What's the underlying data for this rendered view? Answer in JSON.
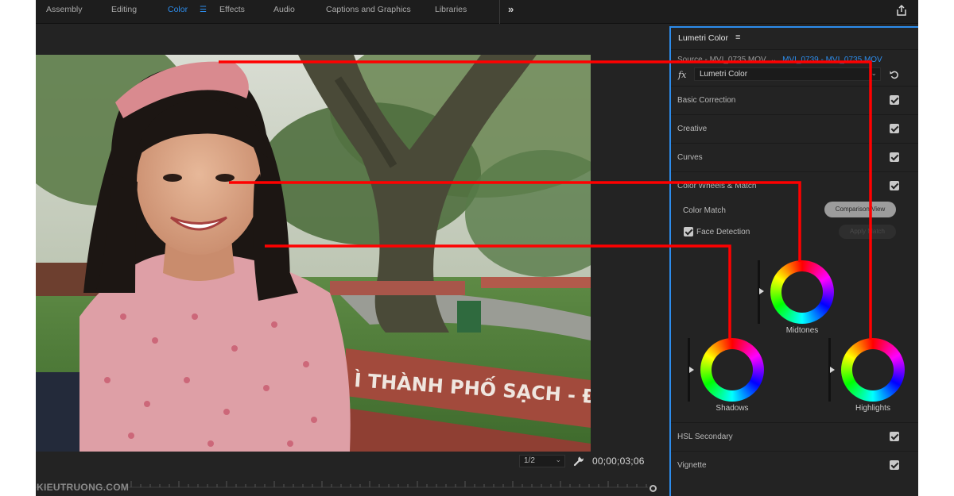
{
  "workspaces": {
    "tabs": [
      {
        "label": "Assembly"
      },
      {
        "label": "Editing"
      },
      {
        "label": "Color"
      },
      {
        "label": "Effects"
      },
      {
        "label": "Audio"
      },
      {
        "label": "Captions and Graphics"
      },
      {
        "label": "Libraries"
      }
    ],
    "active": "Color",
    "more_icon": "double-chevron-right-icon",
    "share_icon": "export-share-icon"
  },
  "monitor": {
    "bench_sign_text": "Ì THÀNH PHỐ SẠCH - ĐẸ",
    "resolution": "1/2",
    "timecode": "00;00;03;06",
    "watermark": "KIEUTRUONG.COM"
  },
  "lumetri": {
    "title": "Lumetri Color",
    "source_label": "Source - MVI_0735.MOV",
    "sequence_label": "MVI_0739 - MVI_0735.MOV",
    "fx_label": "fx",
    "effect_name": "Lumetri Color",
    "sections": [
      {
        "label": "Basic Correction",
        "checked": true
      },
      {
        "label": "Creative",
        "checked": true
      },
      {
        "label": "Curves",
        "checked": true
      },
      {
        "label": "Color Wheels & Match",
        "checked": true
      }
    ],
    "color_match": {
      "label": "Color Match",
      "comparison_button": "Comparison View",
      "face_detection_label": "Face Detection",
      "face_detection_checked": true,
      "apply_button": "Apply Match"
    },
    "wheels": {
      "midtones": "Midtones",
      "shadows": "Shadows",
      "highlights": "Highlights"
    },
    "bottom_sections": [
      {
        "label": "HSL Secondary",
        "checked": true
      },
      {
        "label": "Vignette",
        "checked": true
      }
    ]
  },
  "colors": {
    "accent": "#2d8ceb",
    "callout": "#ff0000",
    "panel_bg": "#232323"
  }
}
